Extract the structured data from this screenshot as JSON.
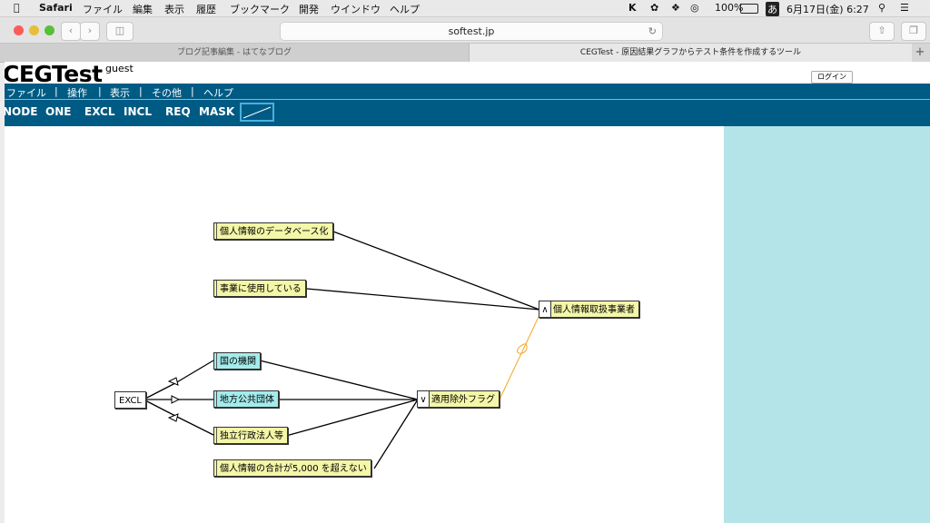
{
  "menubar": {
    "app": "Safari",
    "items": [
      "ファイル",
      "編集",
      "表示",
      "履歴",
      "ブックマーク",
      "開発",
      "ウインドウ",
      "ヘルプ"
    ],
    "battery": "100%",
    "ime": "あ",
    "datetime": "6月17日(金)  6:27"
  },
  "browser": {
    "url": "softest.jp",
    "tabs": [
      {
        "label": "ブログ記事編集 - はてなブログ",
        "active": false
      },
      {
        "label": "CEGTest - 原因結果グラフからテスト条件を作成するツール",
        "active": true
      }
    ],
    "plus": "+"
  },
  "app": {
    "logo": "CEGTest",
    "user": "guest",
    "login_label": "ログイン",
    "menu": [
      "ファイル",
      "操作",
      "表示",
      "その他",
      "ヘルプ"
    ],
    "menu_sep": "|",
    "tools": [
      "NODE",
      "ONE",
      "EXCL",
      "INCL",
      "REQ",
      "MASK"
    ]
  },
  "graph": {
    "nodes": {
      "n1": {
        "label": "個人情報のデータベース化"
      },
      "n2": {
        "label": "事業に使用している"
      },
      "n3": {
        "label": "個人情報取扱事業者",
        "op": "∧"
      },
      "n4": {
        "label": "国の機関"
      },
      "n5": {
        "label": "地方公共団体"
      },
      "n6": {
        "label": "独立行政法人等"
      },
      "n7": {
        "label": "個人情報の合計が5,000 を超えない"
      },
      "n8": {
        "label": "適用除外フラグ",
        "op": "∨"
      },
      "excl": {
        "label": "EXCL"
      }
    },
    "colors": {
      "yellow": "#f4f6a8",
      "cyan": "#a4ecec",
      "mask_line": "#f5a623",
      "sidebar": "#b4e3e8",
      "bar": "#005b84"
    }
  }
}
